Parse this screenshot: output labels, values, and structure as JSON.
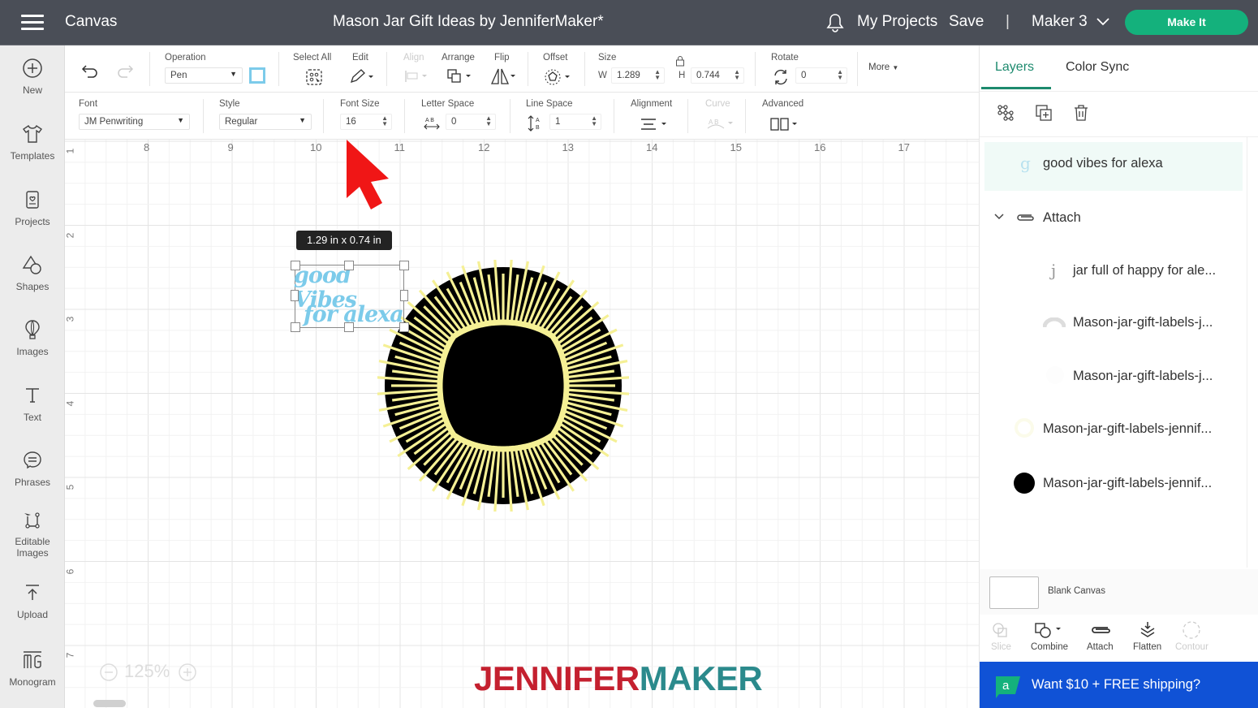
{
  "header": {
    "section_label": "Canvas",
    "project_title": "Mason Jar Gift Ideas by JenniferMaker*",
    "my_projects": "My Projects",
    "save": "Save",
    "separator": "|",
    "machine": "Maker 3",
    "make_it": "Make It",
    "accent_color": "#14b17c"
  },
  "sidebar": {
    "items": [
      {
        "label": "New",
        "icon": "plus-circle-icon"
      },
      {
        "label": "Templates",
        "icon": "shirt-icon"
      },
      {
        "label": "Projects",
        "icon": "project-card-icon"
      },
      {
        "label": "Shapes",
        "icon": "shapes-icon"
      },
      {
        "label": "Images",
        "icon": "hot-air-balloon-icon"
      },
      {
        "label": "Text",
        "icon": "text-icon"
      },
      {
        "label": "Phrases",
        "icon": "speech-bubble-icon"
      },
      {
        "label": "Editable",
        "label2": "Images",
        "icon": "editable-images-icon"
      },
      {
        "label": "Upload",
        "icon": "upload-icon"
      },
      {
        "label": "Monogram",
        "icon": "monogram-icon"
      }
    ]
  },
  "toolbar": {
    "operation_label": "Operation",
    "operation_value": "Pen",
    "operation_color": "#7ccbea",
    "select_all": "Select All",
    "edit": "Edit",
    "align": "Align",
    "arrange": "Arrange",
    "flip": "Flip",
    "offset": "Offset",
    "size": "Size",
    "w_label": "W",
    "w_value": "1.289",
    "h_label": "H",
    "h_value": "0.744",
    "rotate": "Rotate",
    "rotate_value": "0",
    "more": "More"
  },
  "text_toolbar": {
    "font_label": "Font",
    "font_value": "JM Penwriting",
    "style_label": "Style",
    "style_value": "Regular",
    "font_size_label": "Font Size",
    "font_size_value": "16",
    "letter_space_label": "Letter Space",
    "letter_space_value": "0",
    "line_space_label": "Line Space",
    "line_space_value": "1",
    "alignment_label": "Alignment",
    "curve_label": "Curve",
    "advanced_label": "Advanced"
  },
  "canvas": {
    "ruler_top": [
      "8",
      "9",
      "10",
      "11",
      "12",
      "13",
      "14",
      "15",
      "16",
      "17"
    ],
    "ruler_left": [
      "1",
      "2",
      "3",
      "4",
      "5",
      "6",
      "7"
    ],
    "dimension_tooltip": "1.29  in x 0.74  in",
    "text_line1": "good Vibes",
    "text_line2": "for alexa",
    "zoom_level": "125%",
    "watermark_part1": "JENNIFER",
    "watermark_part2": "MAKER",
    "watermark_color1": "#c4202f",
    "watermark_color2": "#2b8a8c"
  },
  "layers_panel": {
    "tabs": [
      "Layers",
      "Color Sync"
    ],
    "layers": [
      {
        "name": "good vibes for alexa",
        "thumb": "g",
        "selected": true
      },
      {
        "name": "Attach",
        "group": true
      },
      {
        "name": "jar full of happy for ale...",
        "thumb": "j"
      },
      {
        "name": "Mason-jar-gift-labels-j...",
        "thumb": "gray-arc"
      },
      {
        "name": "Mason-jar-gift-labels-j...",
        "thumb": "white"
      },
      {
        "name": "Mason-jar-gift-labels-jennif...",
        "thumb": "yellow"
      },
      {
        "name": "Mason-jar-gift-labels-jennif...",
        "thumb": "black"
      }
    ],
    "blank_canvas": "Blank Canvas",
    "operations": [
      {
        "label": "Slice",
        "disabled": true
      },
      {
        "label": "Combine",
        "disabled": false
      },
      {
        "label": "Attach",
        "disabled": false
      },
      {
        "label": "Flatten",
        "disabled": false
      },
      {
        "label": "Contour",
        "disabled": true
      }
    ],
    "promo": "Want $10 + FREE shipping?",
    "promo_color": "#1052d6"
  }
}
